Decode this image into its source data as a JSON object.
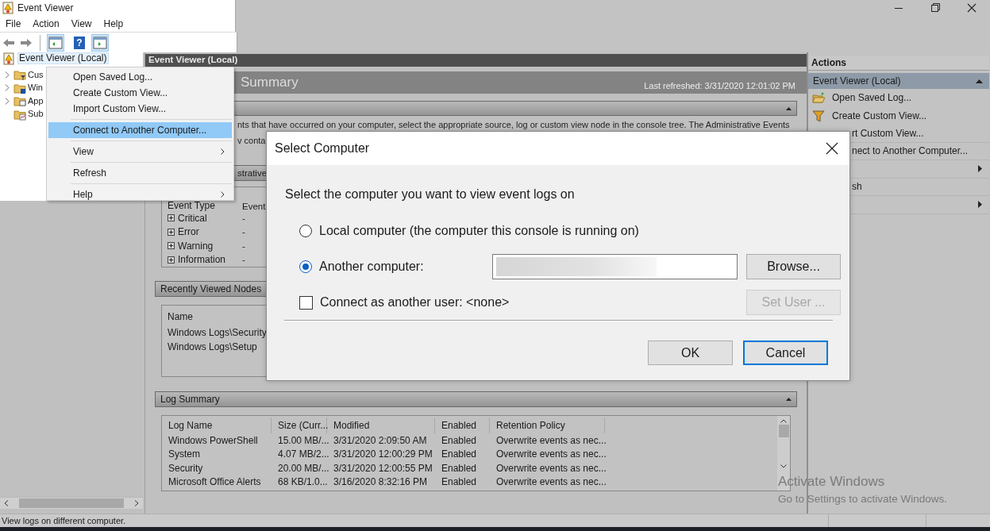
{
  "window": {
    "title": "Event Viewer"
  },
  "menu_bar": [
    "File",
    "Action",
    "View",
    "Help"
  ],
  "toolbar": [
    {
      "kind": "back"
    },
    {
      "kind": "forward"
    },
    {
      "kind": "separator"
    },
    {
      "kind": "tree-toggle",
      "on": true
    },
    {
      "kind": "help",
      "glyph": "?"
    },
    {
      "kind": "action-toggle",
      "on": true
    }
  ],
  "tree": {
    "label": "Event Viewer (Local)",
    "selected": true,
    "children": [
      {
        "label": "Cus",
        "expandable": true,
        "kind": "filter-folder"
      },
      {
        "label": "Win",
        "expandable": true,
        "kind": "log-folder"
      },
      {
        "label": "App",
        "expandable": true,
        "kind": "app-folder"
      },
      {
        "label": "Sub",
        "expandable": false,
        "kind": "sub-folder"
      }
    ]
  },
  "context_menu": [
    {
      "kind": "item",
      "label": "Open Saved Log...",
      "selected": false,
      "submenu": false
    },
    {
      "kind": "item",
      "label": "Create Custom View...",
      "selected": false,
      "submenu": false
    },
    {
      "kind": "item",
      "label": "Import Custom View...",
      "selected": false,
      "submenu": false
    },
    {
      "kind": "separator"
    },
    {
      "kind": "item",
      "label": "Connect to Another Computer...",
      "selected": true,
      "submenu": false
    },
    {
      "kind": "separator"
    },
    {
      "kind": "item",
      "label": "View",
      "selected": false,
      "submenu": true
    },
    {
      "kind": "separator"
    },
    {
      "kind": "item",
      "label": "Refresh",
      "selected": false,
      "submenu": false
    },
    {
      "kind": "separator"
    },
    {
      "kind": "item",
      "label": "Help",
      "selected": false,
      "submenu": true
    }
  ],
  "center": {
    "header": "Event Viewer (Local)",
    "summary_title": "Summary",
    "last_refreshed": "Last refreshed: 3/31/2020 12:01:02 PM",
    "overview_lines": [
      "nts that have occurred on your computer, select the appropriate source, log or custom view node in the console tree. The Administrative Events",
      "v conta"
    ],
    "admin_section": "strative",
    "event_table": {
      "columns": [
        "Event Type",
        "Event"
      ],
      "rows": [
        [
          "Critical",
          "-"
        ],
        [
          "Error",
          "-"
        ],
        [
          "Warning",
          "-"
        ],
        [
          "Information",
          "-"
        ]
      ]
    },
    "recent": {
      "title": "Recently Viewed Nodes",
      "column": "Name",
      "rows": [
        "Windows Logs\\Security",
        "Windows Logs\\Setup"
      ]
    },
    "log_summary": {
      "title": "Log Summary",
      "columns": [
        "Log Name",
        "Size (Curr...",
        "Modified",
        "Enabled",
        "Retention Policy"
      ],
      "rows": [
        [
          "Windows PowerShell",
          "15.00 MB/...",
          "3/31/2020 2:09:50 AM",
          "Enabled",
          "Overwrite events as nec..."
        ],
        [
          "System",
          "4.07 MB/2...",
          "3/31/2020 12:00:29 PM",
          "Enabled",
          "Overwrite events as nec..."
        ],
        [
          "Security",
          "20.00 MB/...",
          "3/31/2020 12:00:55 PM",
          "Enabled",
          "Overwrite events as nec..."
        ],
        [
          "Microsoft Office Alerts",
          "68 KB/1.0...",
          "3/16/2020 8:32:16 PM",
          "Enabled",
          "Overwrite events as nec..."
        ]
      ]
    }
  },
  "actions": {
    "title": "Actions",
    "group": "Event Viewer (Local)",
    "items": [
      {
        "kind": "folder",
        "label": "Open Saved Log...",
        "submenu": false
      },
      {
        "kind": "filter",
        "label": "Create Custom View...",
        "submenu": false
      },
      {
        "kind": "hidden",
        "label": "rt Custom View...",
        "submenu": false
      },
      {
        "kind": "hidden",
        "label": "nect to Another Computer...",
        "submenu": false
      },
      {
        "kind": "hidden",
        "submenu": true
      },
      {
        "kind": "hidden",
        "label": "sh",
        "submenu": false
      },
      {
        "kind": "hidden",
        "submenu": true
      }
    ]
  },
  "dialog": {
    "title": "Select Computer",
    "prompt": "Select the computer you want to view event logs on",
    "options": [
      {
        "label": "Local computer (the computer this console is running on)",
        "selected": false
      },
      {
        "label": "Another computer:",
        "selected": true
      }
    ],
    "computer_field": {
      "blurred": true
    },
    "browse_button": "Browse...",
    "connect_as": {
      "label": "Connect as another user: <none>",
      "checked": false
    },
    "set_user_button": {
      "label": "Set User ...",
      "disabled": true
    },
    "buttons": [
      {
        "label": "OK",
        "focused": false
      },
      {
        "label": "Cancel",
        "focused": true
      }
    ]
  },
  "status_bar": "View logs on different computer.",
  "activation_notice": {
    "title": "Activate Windows",
    "text": "Go to Settings to activate Windows."
  }
}
